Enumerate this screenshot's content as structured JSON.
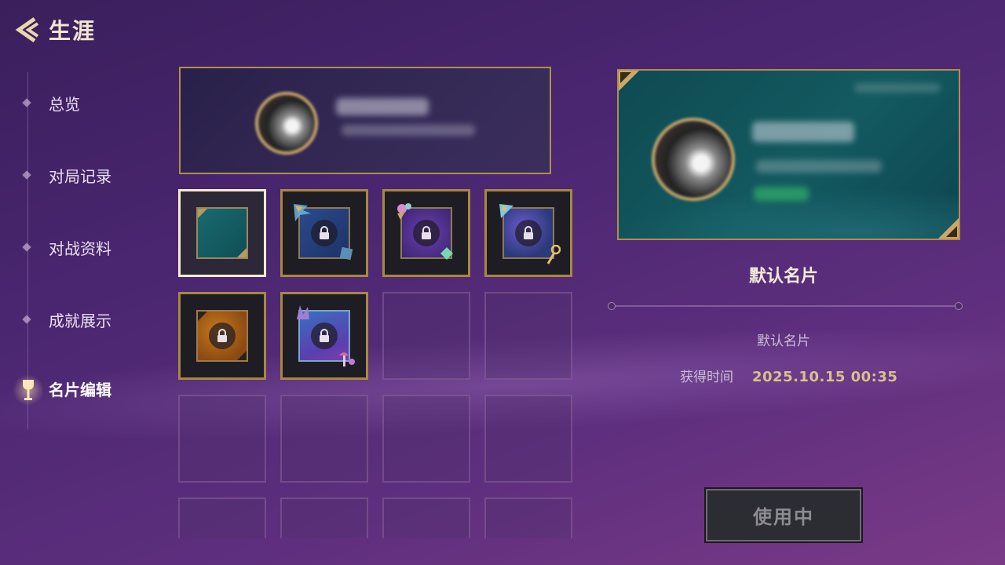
{
  "header": {
    "title": "生涯",
    "back_icon": "back-arrow-icon"
  },
  "sidebar": {
    "items": [
      {
        "label": "总览",
        "active": false
      },
      {
        "label": "对局记录",
        "active": false
      },
      {
        "label": "对战资料",
        "active": false
      },
      {
        "label": "成就展示",
        "active": false
      },
      {
        "label": "名片编辑",
        "active": true,
        "icon": "trophy-cup-icon"
      }
    ]
  },
  "preview": {
    "note": "blurred player name card preview"
  },
  "grid": {
    "rows": 4,
    "cols": 4,
    "slots": [
      {
        "state": "selected",
        "theme": "teal",
        "locked": false
      },
      {
        "state": "filled",
        "theme": "blue",
        "locked": true
      },
      {
        "state": "filled",
        "theme": "violet",
        "locked": true
      },
      {
        "state": "filled",
        "theme": "cosmic",
        "locked": true
      },
      {
        "state": "filled",
        "theme": "orange",
        "locked": true
      },
      {
        "state": "filled",
        "theme": "purple-blue",
        "locked": true
      },
      {
        "state": "empty"
      },
      {
        "state": "empty"
      },
      {
        "state": "empty"
      },
      {
        "state": "empty"
      },
      {
        "state": "empty"
      },
      {
        "state": "empty"
      },
      {
        "state": "empty"
      },
      {
        "state": "empty"
      },
      {
        "state": "empty"
      },
      {
        "state": "empty"
      }
    ]
  },
  "detail": {
    "title": "默认名片",
    "description": "默认名片",
    "obtain_label": "获得时间",
    "obtain_value": "2025.10.15  00:35",
    "button_label": "使用中"
  },
  "colors": {
    "gold": "#b08e4e",
    "selected_border": "#f6eccd",
    "obtain_value": "#d8c18a"
  }
}
